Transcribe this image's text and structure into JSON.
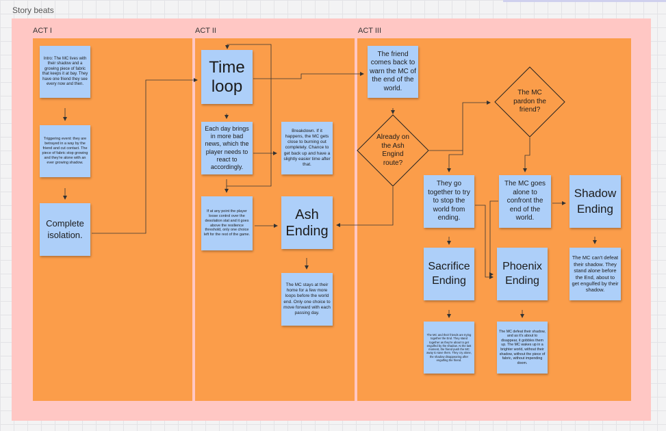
{
  "board": {
    "title": "Story beats"
  },
  "acts": [
    {
      "label": "ACT I"
    },
    {
      "label": "ACT II"
    },
    {
      "label": "ACT III"
    }
  ],
  "notes": {
    "intro": "Intro: The MC lives with their shadow and a growing piece of fabric that keeps it at bay. They have one friend they see every now and then.",
    "triggering": "Triggering event: they are betrayed in a way by the friend and cut contact. The piece of fabric stop growing and they're alone with an ever growing shadow.",
    "isolation": "Complete isolation.",
    "time_loop": "Time loop",
    "each_day": "Each day brings in more bad news, which the player needs to react to accordingly.",
    "breakdown": "Breakdown. If it happens, the MC gets close to burning out completely. Chance to get back up and have a slightly easier time after that.",
    "lose_control": "If at any point the player loose control over the desolation stat and it goes above the resilience threshold, only one choice left for the rest of the game.",
    "ash_ending": "Ash Ending",
    "ash_desc": "The MC stays at their home for a few more loops before the world end. Only one choice to move forward with each passing day.",
    "friend_back": "The friend comes back to warn the MC of the end of the world.",
    "together": "They go together to try to stop the world from ending.",
    "alone": "The MC goes alone to confront the end of the world.",
    "shadow_ending": "Shadow Ending",
    "shadow_desc": "The MC can't defeat their shadow. They stand alone before the End, about to get engulfed by their shadow.",
    "sacrifice_ending": "Sacrifice Ending",
    "phoenix_ending": "Phoenix Ending",
    "sacrifice_desc": "The MC and their friends are trying together the End. They stand together as they're about to get engulfed by the shadow. At the last moment, the friend push the MC away to save them. They cry alone, the shadow disappearing after engulfing the friend.",
    "phoenix_desc": "The MC defeat their shadow, and as it's about to disappear, it gobbles them up. The MC wakes up in a brighter world, without their shadow, without the piece of fabric, without impending doom."
  },
  "decisions": {
    "ash_route": "Already on the Ash Engind route?",
    "pardon": "The MC pardon the friend?"
  },
  "colors": {
    "frame": "#ffc7c4",
    "act": "#fb9d4a",
    "note": "#adcff9",
    "connector": "#333333"
  }
}
